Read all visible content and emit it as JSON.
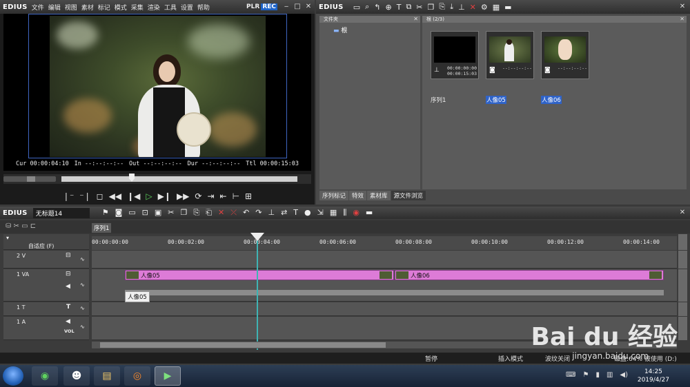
{
  "player": {
    "logo": "EDIUS",
    "menu": [
      "文件",
      "编辑",
      "视图",
      "素材",
      "标记",
      "模式",
      "采集",
      "渲染",
      "工具",
      "设置",
      "帮助"
    ],
    "plr": "PLR",
    "rec": "REC",
    "cur": "Cur 00:00:04:10",
    "in": "In --:--:--:--",
    "out": "Out --:--:--:--",
    "dur": "Dur --:--:--:--",
    "ttl": "Ttl 00:00:15:03"
  },
  "bin": {
    "logo": "EDIUS",
    "folder_header": "文件夹",
    "root_label": "根",
    "clip_header": "根 (2/3)",
    "clips": [
      {
        "name": "序列1",
        "tc1": "00:00:00:00",
        "tc2": "00:00:15:03",
        "selected": false
      },
      {
        "name": "人像05",
        "tc1": "--:--:--:--",
        "tc2": "",
        "selected": true
      },
      {
        "name": "人像06",
        "tc1": "--:--:--:--",
        "tc2": "",
        "selected": true
      }
    ],
    "tabs": [
      "序列标记",
      "特效",
      "素材库",
      "源文件浏览"
    ]
  },
  "timeline": {
    "logo": "EDIUS",
    "project": "无标题14",
    "sequence_tab": "序列1",
    "ruler": [
      "00:00:00:00",
      "00:00:02:00",
      "00:00:04:00",
      "00:00:06:00",
      "00:00:08:00",
      "00:00:10:00",
      "00:00:12:00",
      "00:00:14:00"
    ],
    "mode_label": "自适应 (F)",
    "tracks": [
      "2 V",
      "1 VA",
      "1 T",
      "1 A"
    ],
    "vol_label": "VOL",
    "clip1": "人像05",
    "clip2": "人像06",
    "tooltip": "人像05"
  },
  "status": {
    "pause": "暂停",
    "insert": "插入模式",
    "ripple": "波纹关闭",
    "disk": "磁盘:64% 被使用 (D:)"
  },
  "taskbar": {
    "time": "14:25",
    "date": "2019/4/27"
  },
  "watermark": {
    "brand": "Bai du 经验",
    "url": "jingyan.baidu.com"
  }
}
